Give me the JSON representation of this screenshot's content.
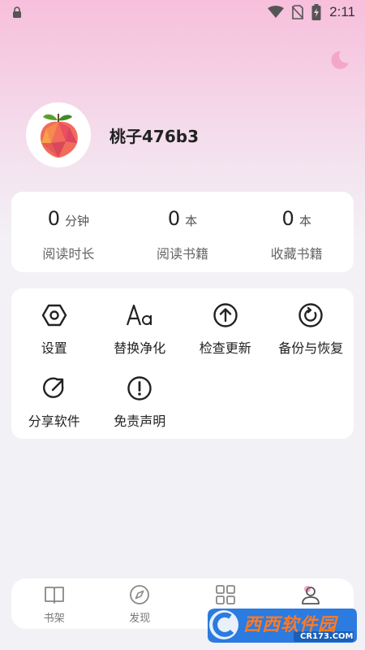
{
  "status_bar": {
    "time": "2:11"
  },
  "profile": {
    "username": "桃子476b3"
  },
  "stats": [
    {
      "value": "0",
      "unit": "分钟",
      "label": "阅读时长"
    },
    {
      "value": "0",
      "unit": "本",
      "label": "阅读书籍"
    },
    {
      "value": "0",
      "unit": "本",
      "label": "收藏书籍"
    }
  ],
  "tools": [
    {
      "label": "设置",
      "icon": "settings-hexagon-icon"
    },
    {
      "label": "替换净化",
      "icon": "font-aa-icon"
    },
    {
      "label": "检查更新",
      "icon": "arrow-up-circle-icon"
    },
    {
      "label": "备份与恢复",
      "icon": "restore-icon"
    },
    {
      "label": "分享软件",
      "icon": "share-icon"
    },
    {
      "label": "免责声明",
      "icon": "exclamation-circle-icon"
    }
  ],
  "bottom_nav": [
    {
      "label": "书架",
      "icon": "book-icon",
      "active": false
    },
    {
      "label": "发现",
      "icon": "compass-icon",
      "active": false
    },
    {
      "label": "",
      "icon": "grid-icon",
      "active": false
    },
    {
      "label": "我的",
      "icon": "user-icon",
      "active": true
    }
  ],
  "watermark": {
    "text": "西西软件园",
    "sub": "CR173.COM"
  },
  "colors": {
    "accent_pink": "#f7bfdc",
    "card_bg": "#ffffff",
    "page_bg": "#f2f1f6",
    "watermark_orange": "#ff7a22"
  }
}
